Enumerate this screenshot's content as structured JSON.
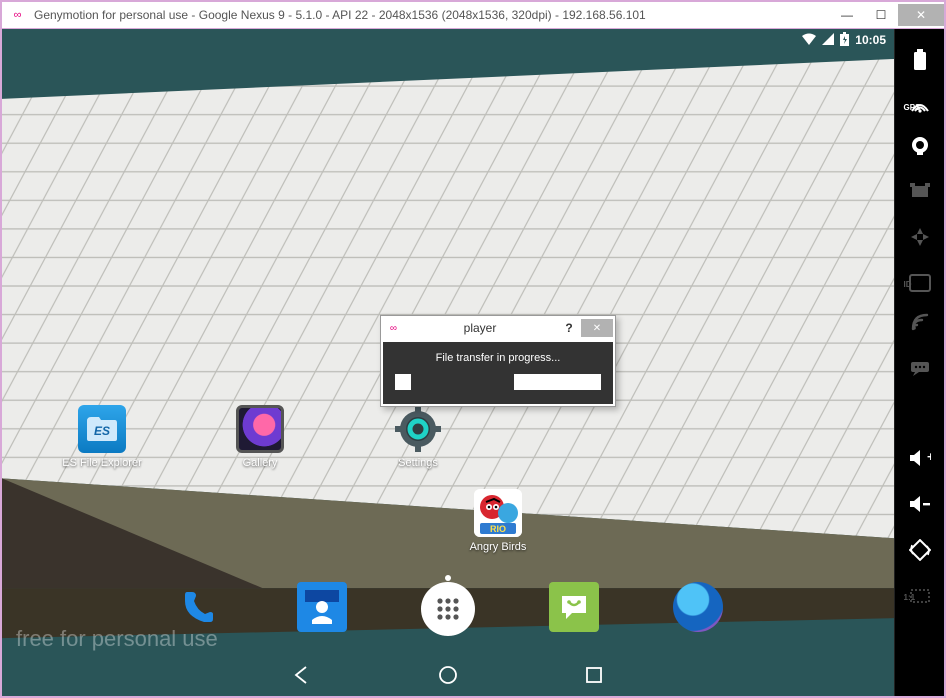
{
  "window": {
    "title": "Genymotion for personal use - Google Nexus 9 - 5.1.0 - API 22 - 2048x1536 (2048x1536, 320dpi) - 192.168.56.101"
  },
  "statusbar": {
    "time": "10:05"
  },
  "home": {
    "apps": [
      {
        "label": "ES File Explorer"
      },
      {
        "label": "Gallery"
      },
      {
        "label": "Settings"
      }
    ],
    "angry_label": "Angry Birds"
  },
  "dialog": {
    "title": "player",
    "message": "File transfer in progress...",
    "progress_percent": 50
  },
  "watermark": "free for personal use",
  "sidebar": {
    "gps_label": "GPS",
    "id_label": "ID",
    "scale_label": "1:1"
  }
}
